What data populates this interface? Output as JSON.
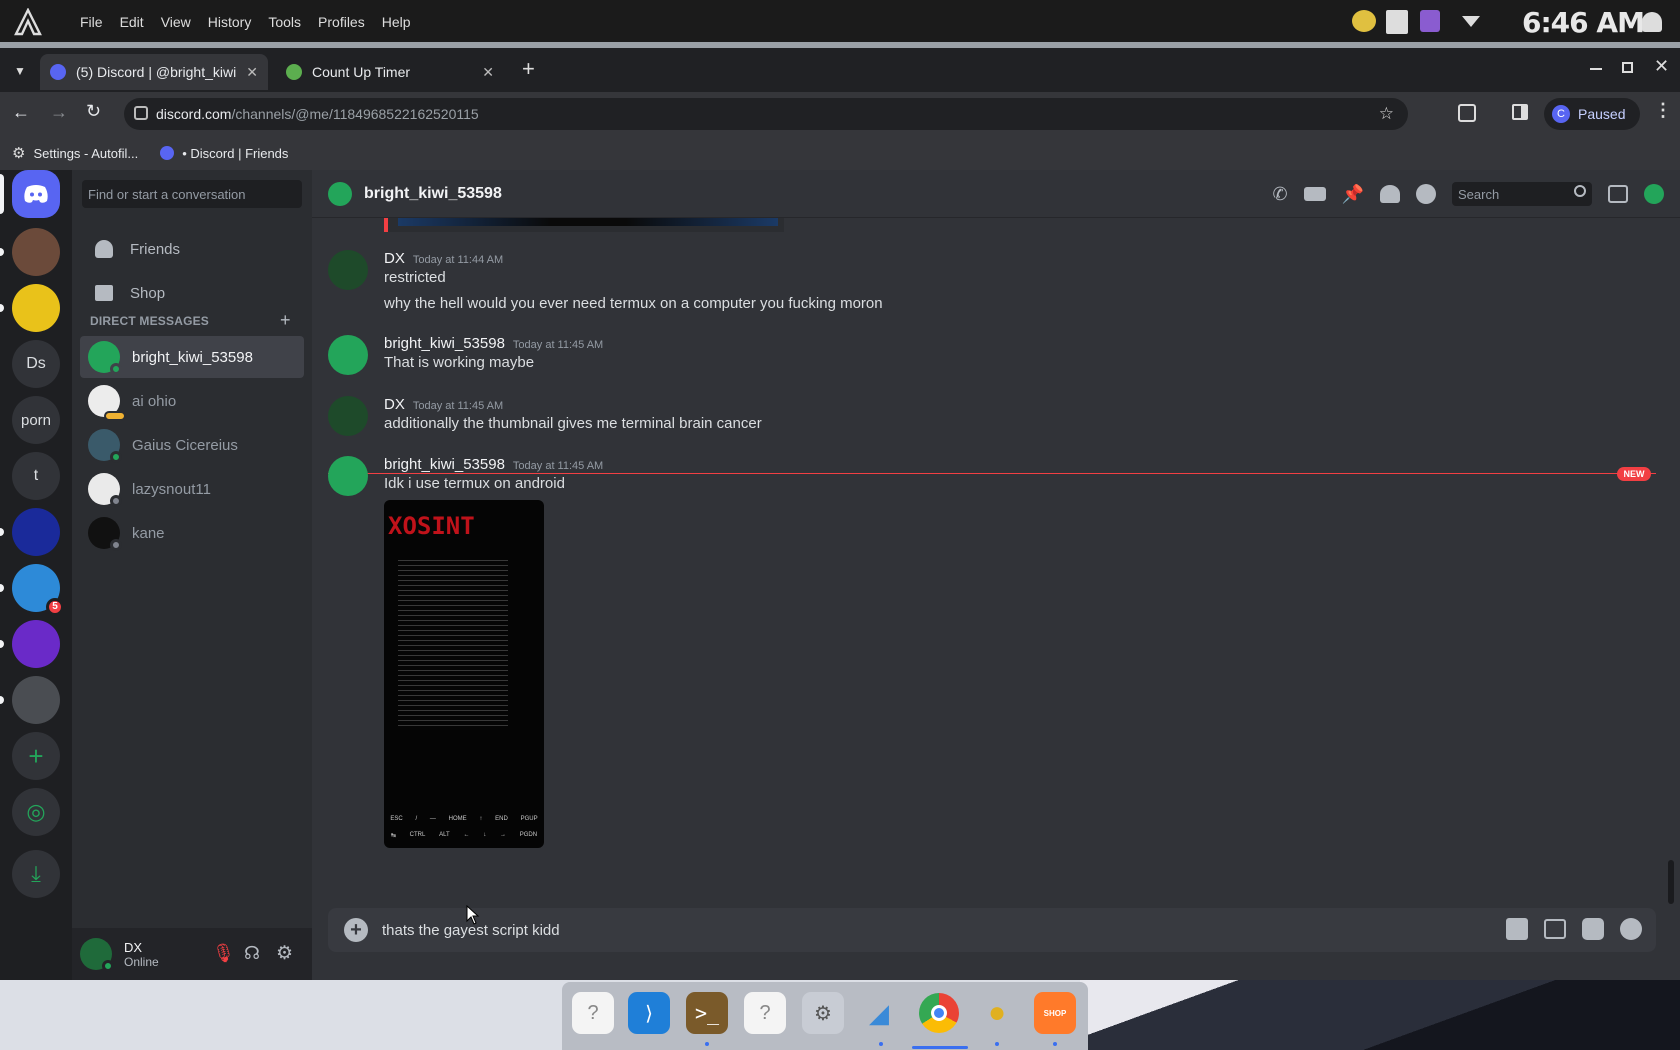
{
  "os_menu": {
    "items": [
      "File",
      "Edit",
      "View",
      "History",
      "Tools",
      "Profiles",
      "Help"
    ],
    "clock": "6:46 AM"
  },
  "browser": {
    "tabs": [
      {
        "label": "(5) Discord | @bright_kiwi",
        "active": true
      },
      {
        "label": "Count Up Timer",
        "active": false
      }
    ],
    "url_host": "discord.com",
    "url_path": "/channels/@me/1184968522162520115",
    "profile_label": "Paused",
    "profile_initial": "C",
    "bookmarks": [
      "Settings - Autofil...",
      "• Discord | Friends"
    ]
  },
  "guilds": {
    "text_servers": [
      "Ds",
      "porn",
      "t"
    ],
    "badge_count": "5"
  },
  "dm_sidebar": {
    "search_placeholder": "Find or start a conversation",
    "nav": [
      "Friends",
      "Shop"
    ],
    "header": "DIRECT MESSAGES",
    "items": [
      "bright_kiwi_53598",
      "ai ohio",
      "Gaius Cicereius",
      "lazysnout11",
      "kane"
    ]
  },
  "user_panel": {
    "name": "DX",
    "status": "Online"
  },
  "chat": {
    "channel_title": "bright_kiwi_53598",
    "search_placeholder": "Search",
    "new_label": "NEW",
    "messages": [
      {
        "author": "DX",
        "time": "Today at 11:44 AM",
        "lines": [
          "restricted",
          "why the hell would you ever need termux on a computer you fucking moron"
        ]
      },
      {
        "author": "bright_kiwi_53598",
        "time": "Today at 11:45 AM",
        "lines": [
          "That is working maybe"
        ]
      },
      {
        "author": "DX",
        "time": "Today at 11:45 AM",
        "lines": [
          "additionally the thumbnail gives me terminal brain cancer"
        ]
      },
      {
        "author": "bright_kiwi_53598",
        "time": "Today at 11:45 AM",
        "lines": [
          "Idk i use termux on android"
        ]
      }
    ],
    "attachment": {
      "title": "XOSINT",
      "keys_row1": [
        "ESC",
        "/",
        "—",
        "HOME",
        "↑",
        "END",
        "PGUP"
      ],
      "keys_row2": [
        "↹",
        "CTRL",
        "ALT",
        "←",
        "↓",
        "→",
        "PGDN"
      ]
    },
    "composer_text": "thats the gayest script kidd"
  },
  "dock": {
    "shop_label": "SHOP"
  },
  "colors": {
    "blurple": "#5865f2",
    "online": "#23a55a",
    "danger": "#f23f43"
  }
}
